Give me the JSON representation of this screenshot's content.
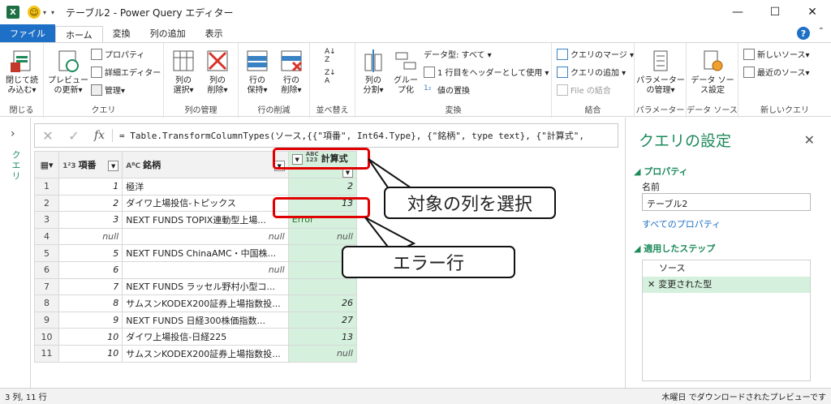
{
  "window": {
    "title": "テーブル2 - Power Query エディター"
  },
  "tabs": [
    {
      "label": "ファイル"
    },
    {
      "label": "ホーム"
    },
    {
      "label": "変換"
    },
    {
      "label": "列の追加"
    },
    {
      "label": "表示"
    }
  ],
  "ribbon": {
    "close_group": {
      "btn": "閉じて読\nみ込む▾",
      "name": "閉じる"
    },
    "query_group": {
      "preview": "プレビュー\nの更新▾",
      "props": "プロパティ",
      "adv": "詳細エディター",
      "manage": "管理▾",
      "name": "クエリ"
    },
    "cols_group": {
      "choose": "列の\n選択▾",
      "remove": "列の\n削除▾",
      "name": "列の管理"
    },
    "rows_group": {
      "keep": "行の\n保持▾",
      "remove": "行の\n削除▾",
      "name": "行の削減"
    },
    "sort_group": {
      "name": "並べ替え"
    },
    "transform_group": {
      "split": "列の\n分割▾",
      "group": "グルー\nプ化",
      "dtype": "データ型: すべて ▾",
      "header": "1 行目をヘッダーとして使用 ▾",
      "replace": "値の置換",
      "name": "変換"
    },
    "combine_group": {
      "merge": "クエリのマージ ▾",
      "append": "クエリの追加 ▾",
      "file": "File の結合",
      "name": "結合"
    },
    "params_group": {
      "btn": "パラメーター\nの管理▾",
      "name": "パラメーター"
    },
    "ds_group": {
      "btn": "データ ソー\nス設定",
      "name": "データ ソース"
    },
    "newq_group": {
      "new": "新しいソース▾",
      "recent": "最近のソース▾",
      "name": "新しいクエリ"
    }
  },
  "leftbar": {
    "label": "クエリ"
  },
  "formula": "= Table.TransformColumnTypes(ソース,{{\"項番\", Int64.Type}, {\"銘柄\", type text}, {\"計算式\",",
  "grid": {
    "headers": [
      {
        "type": "1²3",
        "label": "項番"
      },
      {
        "type": "AᴮC",
        "label": "銘柄"
      },
      {
        "type": "ABC\n123",
        "label": "計算式"
      }
    ],
    "rows": [
      {
        "n": "1",
        "a": "1",
        "b": "極洋",
        "c": "2"
      },
      {
        "n": "2",
        "a": "2",
        "b": "ダイワ上場投信-トピックス",
        "c": "13"
      },
      {
        "n": "3",
        "a": "3",
        "b": "NEXT FUNDS TOPIX連動型上場...",
        "c": "Error"
      },
      {
        "n": "4",
        "a": "null",
        "b": "null",
        "c": "null"
      },
      {
        "n": "5",
        "a": "5",
        "b": "NEXT FUNDS ChinaAMC・中国株...",
        "c": "36"
      },
      {
        "n": "6",
        "a": "6",
        "b": "null",
        "c": ""
      },
      {
        "n": "7",
        "a": "7",
        "b": "NEXT FUNDS ラッセル野村小型コ...",
        "c": ""
      },
      {
        "n": "8",
        "a": "8",
        "b": "サムスンKODEX200証券上場指数投...",
        "c": "26"
      },
      {
        "n": "9",
        "a": "9",
        "b": "NEXT FUNDS 日経300株価指数...",
        "c": "27"
      },
      {
        "n": "10",
        "a": "10",
        "b": "ダイワ上場投信-日経225",
        "c": "13"
      },
      {
        "n": "11",
        "a": "10",
        "b": "サムスンKODEX200証券上場指数投...",
        "c": "null"
      }
    ]
  },
  "callouts": {
    "select_col": "対象の列を選択",
    "error_row": "エラー行"
  },
  "query_settings": {
    "title": "クエリの設定",
    "props_header": "プロパティ",
    "name_label": "名前",
    "name_value": "テーブル2",
    "all_props": "すべてのプロパティ",
    "steps_header": "適用したステップ",
    "steps": [
      {
        "label": "ソース"
      },
      {
        "label": "変更された型"
      }
    ]
  },
  "status": {
    "left": "3 列, 11 行",
    "right": "木曜日 でダウンロードされたプレビューです"
  }
}
